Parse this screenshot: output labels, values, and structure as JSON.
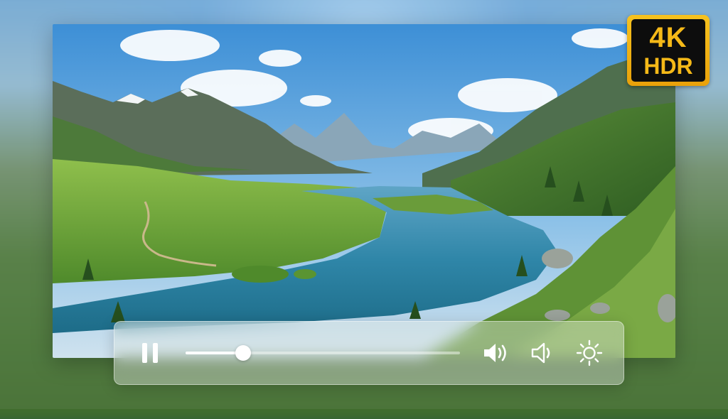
{
  "badge": {
    "resolution": "4K",
    "dynamic_range": "HDR"
  },
  "player": {
    "progress_fraction": 0.21,
    "state": "playing"
  },
  "icons": {
    "pause": "pause-icon",
    "volume_up": "volume-up-icon",
    "volume_down": "volume-down-icon",
    "brightness": "brightness-icon"
  },
  "colors": {
    "badge_gold": "#f5b918",
    "badge_black": "#0d0d0d",
    "control_tint": "#e1e6e1"
  }
}
